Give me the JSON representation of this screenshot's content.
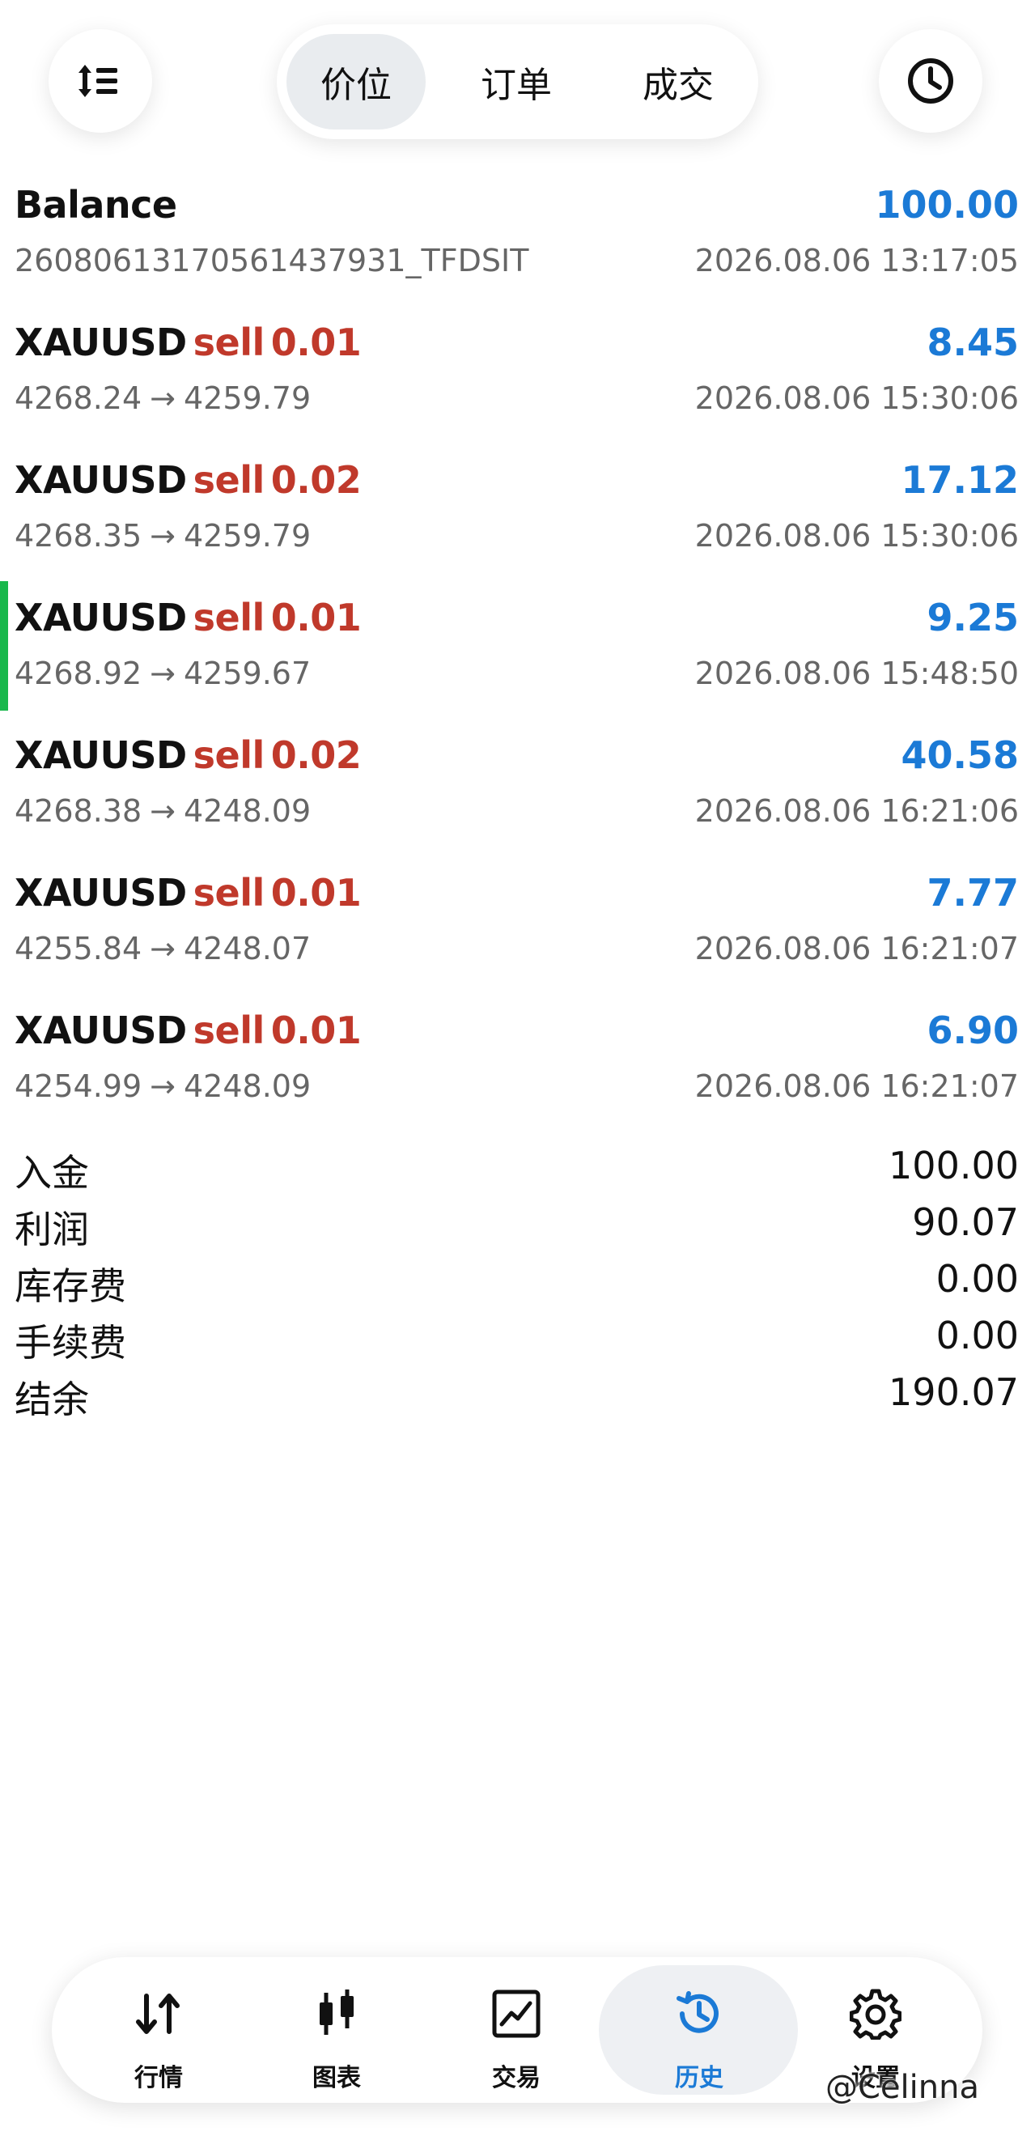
{
  "header": {
    "tabs": [
      {
        "label": "价位",
        "active": true
      },
      {
        "label": "订单",
        "active": false
      },
      {
        "label": "成交",
        "active": false
      }
    ],
    "sort_icon": "sort-icon",
    "history_icon": "clock-icon"
  },
  "balance_row": {
    "title": "Balance",
    "amount": "100.00",
    "ref": "26080613170561437931_TFDSIT",
    "time": "2026.08.06 13:17:05"
  },
  "deals": [
    {
      "symbol": "XAUUSD",
      "side": "sell",
      "volume": "0.01",
      "profit": "8.45",
      "open_price": "4268.24",
      "arrow": "→",
      "close_price": "4259.79",
      "time": "2026.08.06 15:30:06"
    },
    {
      "symbol": "XAUUSD",
      "side": "sell",
      "volume": "0.02",
      "profit": "17.12",
      "open_price": "4268.35",
      "arrow": "→",
      "close_price": "4259.79",
      "time": "2026.08.06 15:30:06"
    },
    {
      "symbol": "XAUUSD",
      "side": "sell",
      "volume": "0.01",
      "profit": "9.25",
      "open_price": "4268.92",
      "arrow": "→",
      "close_price": "4259.67",
      "time": "2026.08.06 15:48:50",
      "selected": true
    },
    {
      "symbol": "XAUUSD",
      "side": "sell",
      "volume": "0.02",
      "profit": "40.58",
      "open_price": "4268.38",
      "arrow": "→",
      "close_price": "4248.09",
      "time": "2026.08.06 16:21:06"
    },
    {
      "symbol": "XAUUSD",
      "side": "sell",
      "volume": "0.01",
      "profit": "7.77",
      "open_price": "4255.84",
      "arrow": "→",
      "close_price": "4248.07",
      "time": "2026.08.06 16:21:07"
    },
    {
      "symbol": "XAUUSD",
      "side": "sell",
      "volume": "0.01",
      "profit": "6.90",
      "open_price": "4254.99",
      "arrow": "→",
      "close_price": "4248.09",
      "time": "2026.08.06 16:21:07"
    }
  ],
  "summary": [
    {
      "label": "入金",
      "value": "100.00"
    },
    {
      "label": "利润",
      "value": "90.07"
    },
    {
      "label": "库存费",
      "value": "0.00"
    },
    {
      "label": "手续费",
      "value": "0.00"
    },
    {
      "label": "结余",
      "value": "190.07"
    }
  ],
  "bottom_nav": [
    {
      "label": "行情",
      "icon": "quotes-arrows-icon",
      "active": false
    },
    {
      "label": "图表",
      "icon": "candlestick-chart-icon",
      "active": false
    },
    {
      "label": "交易",
      "icon": "trade-chart-icon",
      "active": false
    },
    {
      "label": "历史",
      "icon": "history-clock-icon",
      "active": true
    },
    {
      "label": "设置",
      "icon": "gear-icon",
      "active": false
    }
  ],
  "colors": {
    "profit_blue": "#1b7ad6",
    "sell_red": "#c0392b",
    "selected_indicator": "#19b84c",
    "secondary_text": "#666666"
  },
  "watermark": "@Celinna"
}
